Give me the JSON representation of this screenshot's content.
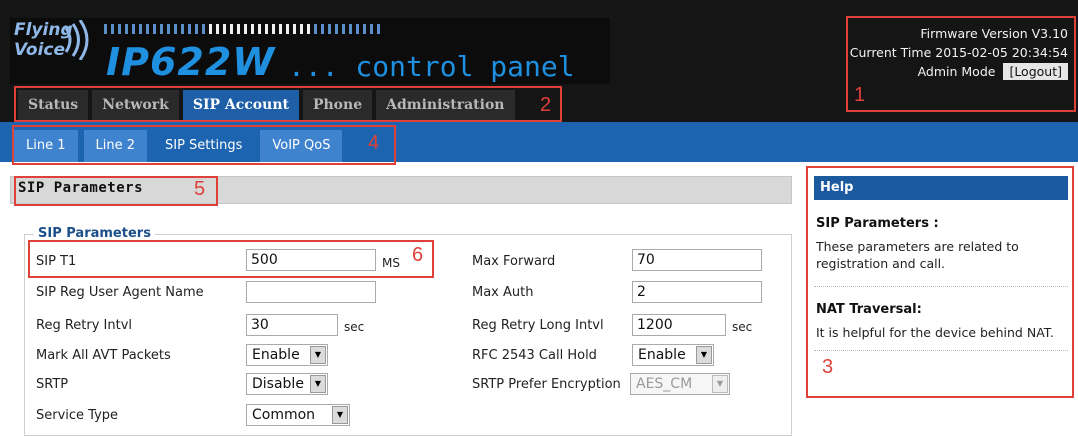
{
  "brand": {
    "line1": "Flying",
    "line2": "Voice",
    "model": "IP622W",
    "suffix": "... control panel"
  },
  "info": {
    "firmware": "Firmware Version V3.10",
    "time": "Current Time 2015-02-05 20:34:54",
    "mode_label": "Admin Mode",
    "logout_label": "[Logout]"
  },
  "tabs": [
    {
      "label": "Status"
    },
    {
      "label": "Network"
    },
    {
      "label": "SIP Account"
    },
    {
      "label": "Phone"
    },
    {
      "label": "Administration"
    }
  ],
  "subtabs": [
    {
      "label": "Line 1"
    },
    {
      "label": "Line 2"
    },
    {
      "label": "SIP Settings"
    },
    {
      "label": "VoIP QoS"
    }
  ],
  "section": {
    "title": "SIP Parameters",
    "legend": "SIP Parameters"
  },
  "form": {
    "sip_t1": {
      "label": "SIP T1",
      "value": "500",
      "unit": "MS"
    },
    "ua_name": {
      "label": "SIP Reg User Agent Name",
      "value": ""
    },
    "retry": {
      "label": "Reg Retry Intvl",
      "value": "30",
      "unit": "sec"
    },
    "avt": {
      "label": "Mark All AVT Packets",
      "value": "Enable"
    },
    "srtp": {
      "label": "SRTP",
      "value": "Disable"
    },
    "service": {
      "label": "Service Type",
      "value": "Common"
    },
    "max_forward": {
      "label": "Max Forward",
      "value": "70"
    },
    "max_auth": {
      "label": "Max Auth",
      "value": "2"
    },
    "retry_long": {
      "label": "Reg Retry Long Intvl",
      "value": "1200",
      "unit": "sec"
    },
    "rfc2543": {
      "label": "RFC 2543 Call Hold",
      "value": "Enable"
    },
    "srtp_enc": {
      "label": "SRTP Prefer Encryption",
      "value": "AES_CM"
    }
  },
  "help": {
    "heading": "Help",
    "t1": "SIP Parameters :",
    "d1": "These parameters are related to registration and call.",
    "t2": "NAT Traversal:",
    "d2": "It is helpful for the device behind NAT."
  },
  "annotations": [
    "1",
    "2",
    "3",
    "4",
    "5",
    "6"
  ],
  "colors": {
    "accent": "#1d64b0",
    "annotation": "#e0403a",
    "header_bg": "#151515"
  }
}
